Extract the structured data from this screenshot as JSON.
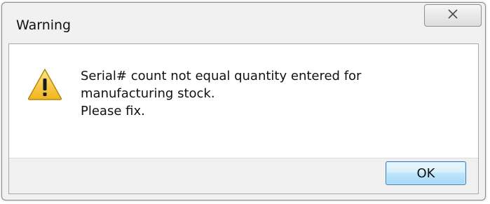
{
  "window": {
    "title": "Warning",
    "close_icon": "close-x-icon"
  },
  "message": {
    "icon": "warning-icon",
    "lines": [
      "Serial# count not equal quantity entered for",
      "manufacturing stock.",
      "Please fix."
    ]
  },
  "buttons": {
    "ok_label": "OK"
  },
  "colors": {
    "warning_fill": "#f2c230",
    "button_border": "#3c7fb1"
  }
}
